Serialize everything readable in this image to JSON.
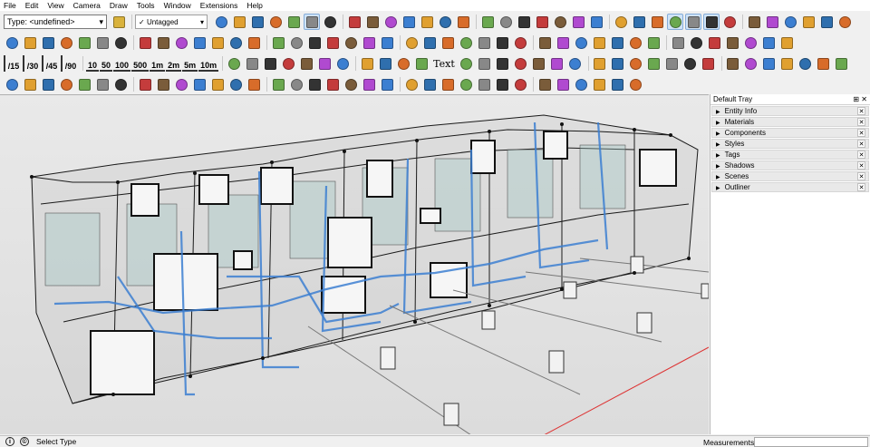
{
  "menu": [
    "File",
    "Edit",
    "View",
    "Camera",
    "Draw",
    "Tools",
    "Window",
    "Extensions",
    "Help"
  ],
  "toolbar": {
    "type_selector": "Type: <undefined>",
    "tag_selector": "Untagged",
    "angle_buttons": [
      "/15",
      "/30",
      "/45",
      "/90"
    ],
    "dimension_buttons": [
      "10",
      "50",
      "100",
      "500",
      "1m",
      "2m",
      "5m",
      "10m"
    ],
    "text_tool": "Text",
    "accent_color": "#3c7fd1"
  },
  "tray": {
    "title": "Default Tray",
    "panels": [
      "Entity Info",
      "Materials",
      "Components",
      "Styles",
      "Tags",
      "Shadows",
      "Scenes",
      "Outliner"
    ]
  },
  "status": {
    "hint": "Select Type",
    "measurements_label": "Measurements",
    "measurements_value": ""
  }
}
